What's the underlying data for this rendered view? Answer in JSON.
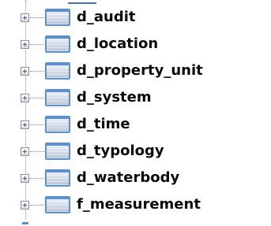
{
  "tree": {
    "items": [
      {
        "label": "d_audit",
        "icon": "table-icon",
        "expander": "plus"
      },
      {
        "label": "d_location",
        "icon": "table-icon",
        "expander": "plus"
      },
      {
        "label": "d_property_unit",
        "icon": "table-icon",
        "expander": "plus"
      },
      {
        "label": "d_system",
        "icon": "table-icon",
        "expander": "plus"
      },
      {
        "label": "d_time",
        "icon": "table-icon",
        "expander": "plus"
      },
      {
        "label": "d_typology",
        "icon": "table-icon",
        "expander": "plus"
      },
      {
        "label": "d_waterbody",
        "icon": "table-icon",
        "expander": "plus"
      },
      {
        "label": "f_measurement",
        "icon": "table-icon",
        "expander": "plus"
      }
    ]
  },
  "colors": {
    "icon_border": "#5b8fd6",
    "text": "#0b0b0b",
    "connector": "#8a8a8a"
  }
}
